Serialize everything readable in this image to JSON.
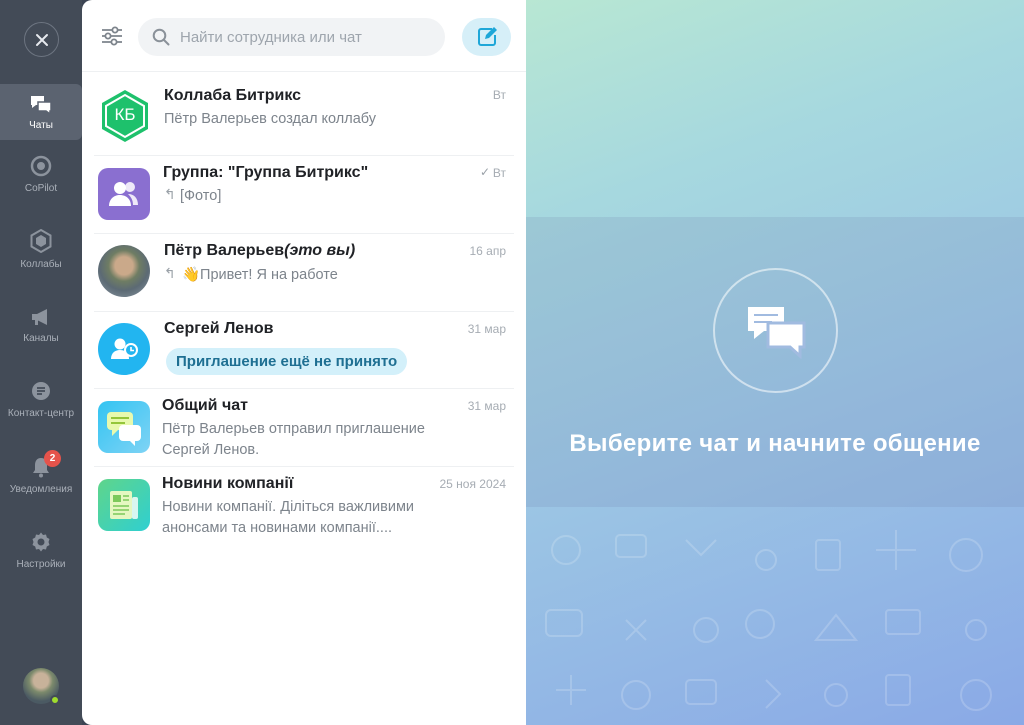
{
  "nav": {
    "items": [
      {
        "label": "Чаты",
        "icon": "chat-bubbles-icon",
        "active": true
      },
      {
        "label": "CoPilot",
        "icon": "copilot-icon"
      },
      {
        "label": "Коллабы",
        "icon": "hexagon-icon"
      },
      {
        "label": "Каналы",
        "icon": "megaphone-icon"
      },
      {
        "label": "Контакт-центр",
        "icon": "contact-center-icon"
      },
      {
        "label": "Уведомления",
        "icon": "bell-icon",
        "badge": "2"
      },
      {
        "label": "Настройки",
        "icon": "gear-icon"
      }
    ]
  },
  "search": {
    "placeholder": "Найти сотрудника или чат"
  },
  "chats": [
    {
      "title": "Коллаба Битрикс",
      "date": "Вт",
      "preview": "Пётр Валерьев создал коллабу",
      "avatar_text": "КБ"
    },
    {
      "title": "Группа: \"Группа Битрикс\"",
      "date": "Вт",
      "preview": "[Фото]"
    },
    {
      "title": "Пётр Валерьев",
      "title_suffix": "(это вы)",
      "date": "16 апр",
      "preview": "👋Привет! Я на работе"
    },
    {
      "title": "Сергей Ленов",
      "date": "31 мар",
      "pill": "Приглашение ещё не принято"
    },
    {
      "title": "Общий чат",
      "date": "31 мар",
      "preview": "Пётр Валерьев отправил приглашение Сергей Ленов."
    },
    {
      "title": "Новини компанії",
      "date": "25 ноя 2024",
      "preview": "Новини компанії. Діліться важливими анонсами та новинами компанії...."
    }
  ],
  "empty_state": {
    "text": "Выберите чат и начните общение"
  },
  "colors": {
    "rail": "#434b57",
    "accent": "#2fc6f6",
    "collab_green": "#1ec16c"
  }
}
